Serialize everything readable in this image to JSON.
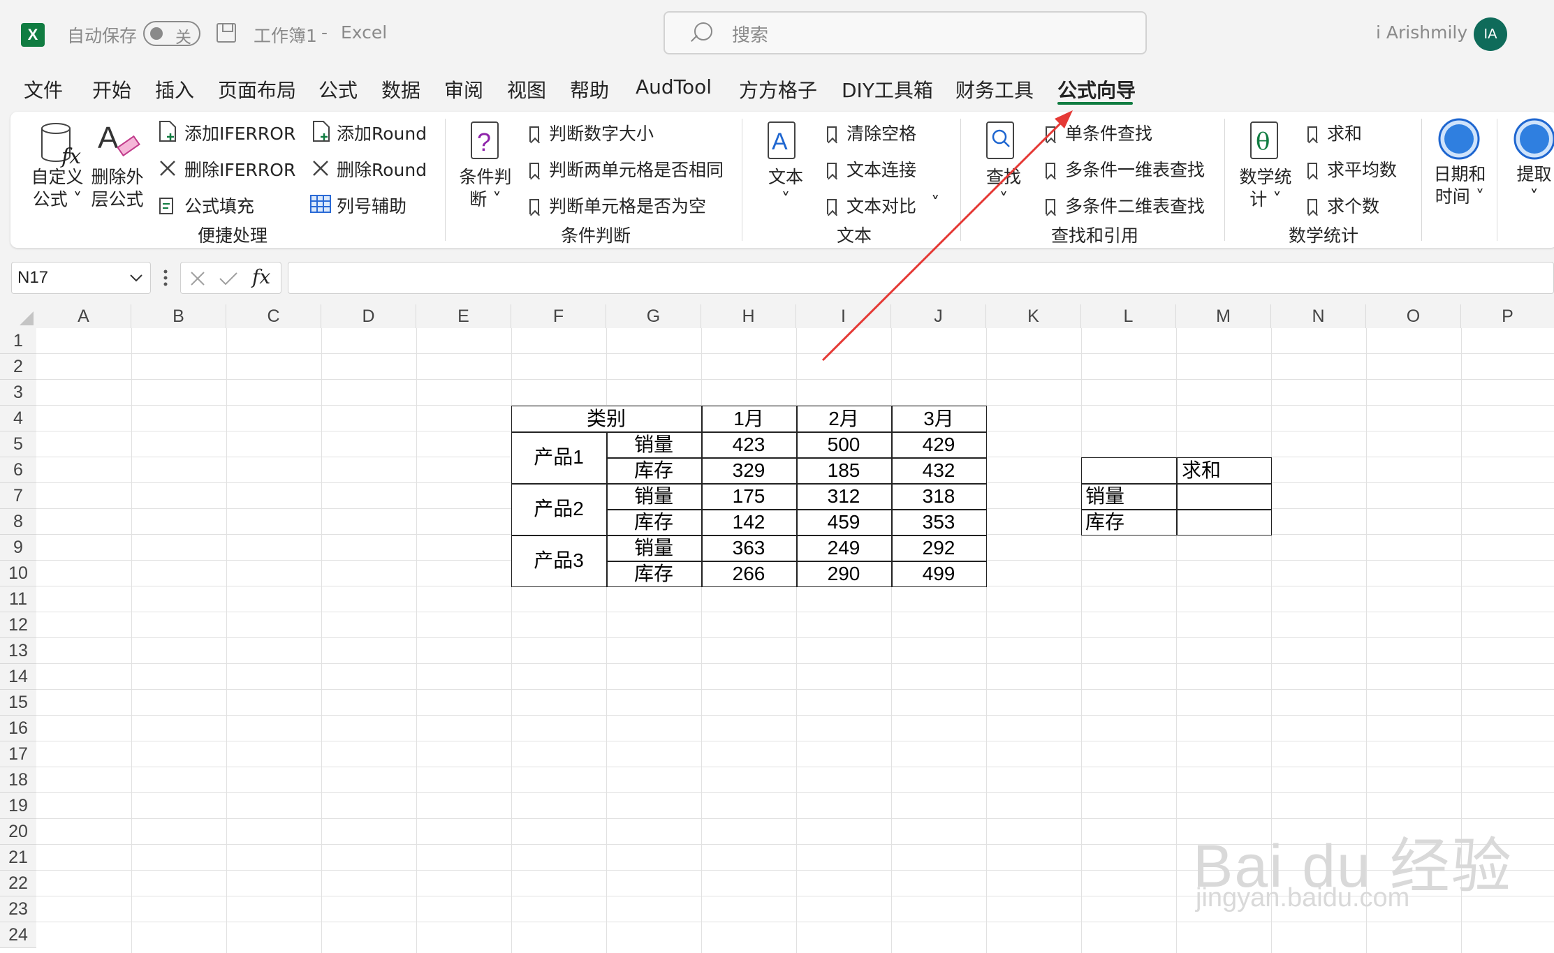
{
  "titlebar": {
    "autosave_label": "自动保存",
    "autosave_state": "关",
    "workbook": "工作簿1",
    "separator": "-",
    "app": "Excel",
    "search_placeholder": "搜索",
    "user_name": "i Arishmily",
    "user_initials": "IA"
  },
  "menu": {
    "tabs": [
      "文件",
      "开始",
      "插入",
      "页面布局",
      "公式",
      "数据",
      "审阅",
      "视图",
      "帮助",
      "AudTool",
      "方方格子",
      "DIY工具箱",
      "财务工具",
      "公式向导"
    ],
    "active": "公式向导"
  },
  "ribbon": {
    "g1": {
      "label": "便捷处理",
      "custom_formula": "自定义\n公式 ˅",
      "remove_outer": "删除外\n层公式",
      "add_iferror": "添加IFERROR",
      "del_iferror": "删除IFERROR",
      "formula_fill": "公式填充",
      "add_round": "添加Round",
      "del_round": "删除Round",
      "col_helper": "列号辅助"
    },
    "g2": {
      "label": "条件判断",
      "big": "条件判\n断 ˅",
      "i1": "判断数字大小",
      "i2": "判断两单元格是否相同",
      "i3": "判断单元格是否为空"
    },
    "g3": {
      "label": "文本",
      "big": "文本\n˅",
      "i1": "清除空格",
      "i2": "文本连接",
      "i3": "文本对比",
      "more": "˅"
    },
    "g4": {
      "label": "查找和引用",
      "big": "查找\n˅",
      "i1": "单条件查找",
      "i2": "多条件一维表查找",
      "i3": "多条件二维表查找"
    },
    "g5": {
      "label": "数学统计",
      "big": "数学统\n计 ˅",
      "i1": "求和",
      "i2": "求平均数",
      "i3": "求个数"
    },
    "g6": {
      "big": "日期和\n时间 ˅"
    },
    "g7": {
      "big": "提取\n˅"
    }
  },
  "formula_bar": {
    "name_box": "N17",
    "fx": "fx",
    "formula": ""
  },
  "grid": {
    "columns": [
      "A",
      "B",
      "C",
      "D",
      "E",
      "F",
      "G",
      "H",
      "I",
      "J",
      "K",
      "L",
      "M",
      "N",
      "O",
      "P"
    ],
    "rows": [
      "1",
      "2",
      "3",
      "4",
      "5",
      "6",
      "7",
      "8",
      "9",
      "10",
      "11",
      "12",
      "13",
      "14",
      "15",
      "16",
      "17",
      "18",
      "19",
      "20",
      "21",
      "22",
      "23",
      "24"
    ]
  },
  "table1": {
    "header": [
      "类别",
      "1月",
      "2月",
      "3月"
    ],
    "products": [
      "产品1",
      "产品2",
      "产品3"
    ],
    "rows": [
      {
        "type": "销量",
        "v": [
          "423",
          "500",
          "429"
        ]
      },
      {
        "type": "库存",
        "v": [
          "329",
          "185",
          "432"
        ]
      },
      {
        "type": "销量",
        "v": [
          "175",
          "312",
          "318"
        ]
      },
      {
        "type": "库存",
        "v": [
          "142",
          "459",
          "353"
        ]
      },
      {
        "type": "销量",
        "v": [
          "363",
          "249",
          "292"
        ]
      },
      {
        "type": "库存",
        "v": [
          "266",
          "290",
          "499"
        ]
      }
    ]
  },
  "table2": {
    "header": "求和",
    "rows": [
      "销量",
      "库存"
    ]
  },
  "watermark": {
    "brand": "Bai du 经验",
    "url": "jingyan.baidu.com"
  },
  "colors": {
    "accent": "#107c41",
    "arrow": "#e53935"
  }
}
